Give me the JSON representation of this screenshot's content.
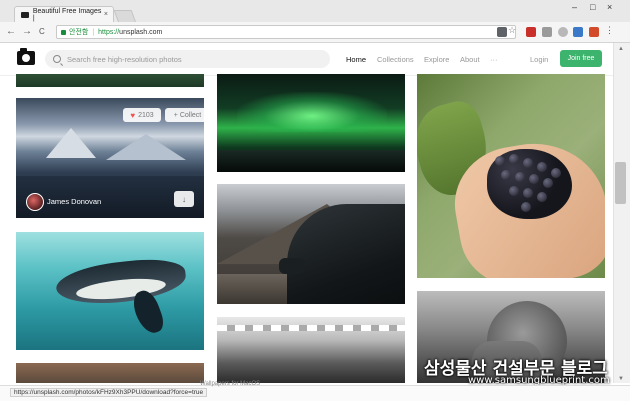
{
  "browser": {
    "tab_title": "Beautiful Free Images |",
    "tab_close": "×",
    "user_label": "",
    "window_controls": [
      "–",
      "□",
      "×"
    ],
    "nav_icons": [
      "←",
      "→",
      "C"
    ],
    "secure_label": "안전함",
    "url_scheme": "https://",
    "url_host": "unsplash.com",
    "extension_icons": [
      "translate-icon",
      "star-icon",
      "pdf-icon",
      "ext-icon",
      "cloud-icon",
      "iq-icon",
      "flag-icon",
      "menu-icon"
    ]
  },
  "site": {
    "search_placeholder": "Search free high-resolution photos",
    "nav": [
      "Home",
      "Collections",
      "Explore",
      "About",
      "···"
    ],
    "login": "Login",
    "join": "Join free"
  },
  "photos": {
    "featured": {
      "likes": "2103",
      "collect_label": "+ Collect",
      "author": "James Donovan",
      "download_icon": "↓"
    }
  },
  "status": {
    "link_url": "https://unsplash.com/photos/kFHz9Xh3PPU/download?force=true",
    "faded_text": "Wallpapers for MacOS"
  },
  "watermark": {
    "korean": "삼성물산 건설부문 블로그",
    "english": "www.samsungblueprint.com"
  },
  "colors": {
    "join_button": "#3cb46e",
    "secure_green": "#1a8d3b",
    "like_heart": "#f15151"
  }
}
